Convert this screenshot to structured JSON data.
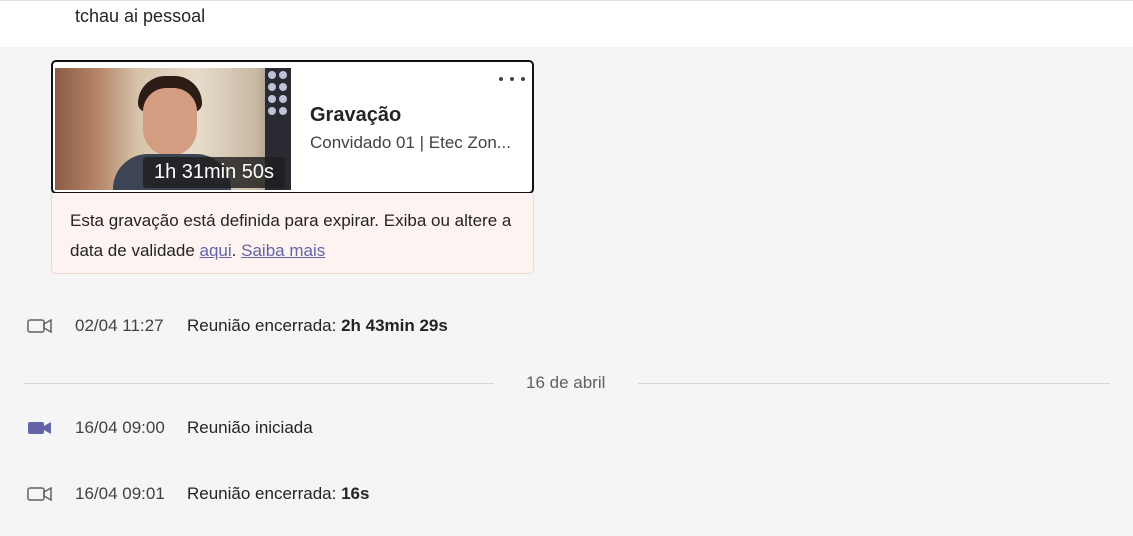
{
  "message": {
    "text": "tchau ai pessoal"
  },
  "recording": {
    "duration": "1h 31min 50s",
    "title": "Gravação",
    "subtitle": "Convidado 01 | Etec Zon...",
    "more_label": "More options",
    "expiry_text": "Esta gravação está definida para expirar. Exiba ou altere a data de validade",
    "expiry_link_here": "aqui",
    "expiry_sep": ".",
    "expiry_link_more": "Saiba mais"
  },
  "events": [
    {
      "icon": "video-outline-icon",
      "time": "02/04 11:27",
      "text": "Reunião encerrada:",
      "bold": "2h 43min 29s"
    },
    {
      "icon": "video-filled-icon",
      "time": "16/04 09:00",
      "text": "Reunião iniciada",
      "bold": ""
    },
    {
      "icon": "video-outline-icon",
      "time": "16/04 09:01",
      "text": "Reunião encerrada:",
      "bold": "16s"
    }
  ],
  "date_separator": "16 de abril",
  "colors": {
    "accent": "#6264a7",
    "expiry_bg": "#fdf3f1"
  }
}
